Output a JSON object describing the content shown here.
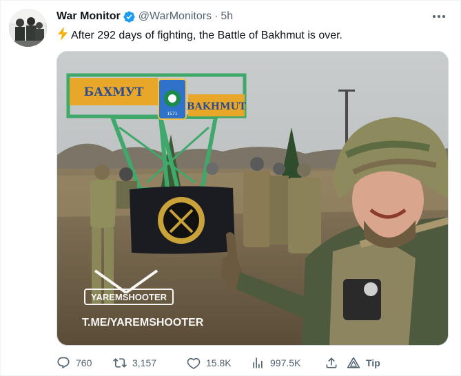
{
  "author": {
    "name": "War Monitor",
    "handle": "@WarMonitors",
    "separator": "·",
    "time": "5h"
  },
  "tweet": {
    "emoji_icon": "lightning-bolt-icon",
    "text": "After 292 days of fighting, the Battle of Bakhmut is over."
  },
  "image": {
    "sign_left": "БАХМУТ",
    "sign_right": "BAKHMUT",
    "crest_year": "1571",
    "watermark_name": "YAREMSHOOTER",
    "watermark_link": "T.ME/YAREMSHOOTER"
  },
  "actions": {
    "replies": "760",
    "retweets": "3,157",
    "likes": "15.8K",
    "views": "997.5K",
    "tip": "Tip"
  },
  "colors": {
    "text_primary": "#0f1419",
    "text_secondary": "#536471",
    "verified": "#1d9bf0",
    "bolt": "#f4b30a"
  }
}
